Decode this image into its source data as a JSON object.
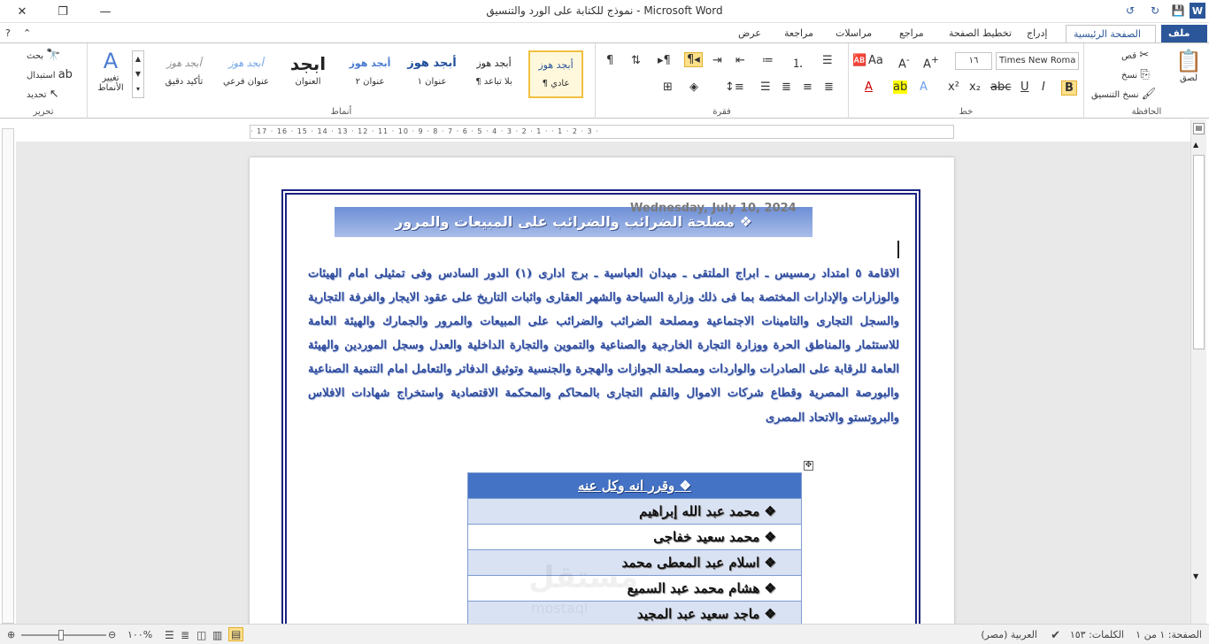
{
  "window": {
    "title": "نموذج للكتابة على الورد والتنسيق  -  Microsoft Word"
  },
  "tabs": [
    {
      "label": "ملف"
    },
    {
      "label": "الصفحة الرئيسية"
    },
    {
      "label": "إدراج"
    },
    {
      "label": "تخطيط الصفحة"
    },
    {
      "label": "مراجع"
    },
    {
      "label": "مراسلات"
    },
    {
      "label": "مراجعة"
    },
    {
      "label": "عرض"
    }
  ],
  "ribbon": {
    "clipboard": {
      "label": "الحافظة",
      "paste": "لصق",
      "cut": "قص",
      "copy": "نسخ",
      "format_painter": "نسخ التنسيق"
    },
    "font": {
      "label": "خط",
      "font_name": "Times New Roma",
      "font_size": "١٦"
    },
    "paragraph": {
      "label": "فقرة"
    },
    "styles": {
      "label": "أنماط",
      "items": [
        {
          "preview": "أبجد هوز",
          "name": "¶ عادي"
        },
        {
          "preview": "أبجد هوز",
          "name": "¶ بلا تباعد"
        },
        {
          "preview": "أبجد هوز",
          "name": "عنوان ١"
        },
        {
          "preview": "أبجد هوز",
          "name": "عنوان ٢"
        },
        {
          "preview": "ابجد",
          "name": "العنوان"
        },
        {
          "preview": "أبجد هوز",
          "name": "عنوان فرعي"
        },
        {
          "preview": "أبجد هوز",
          "name": "تأكيد دقيق"
        }
      ],
      "change_styles": "تغيير الأنماط"
    },
    "editing": {
      "label": "تحرير",
      "find": "بحث",
      "replace": "استبدال",
      "select": "تحديد"
    }
  },
  "ruler": {
    "numbers": "· 17 · 16 · 15 · 14 · 13 · 12 · 11 · 10 · 9 · 8 · 7 · 6 · 5 · 4 · 3 · 2 · 1 ·  · 1 · 2 · 3 ·"
  },
  "document": {
    "banner_title": "❖ مصلحة الضرائب والضرائب على المبيعات والمرور",
    "date_stamp": "Wednesday, July 10, 2024",
    "paragraph": "الاقامة ٥ امتداد رمسيس ـ ابراج الملتقى ـ ميدان العباسية ـ برج ادارى (١) الدور السادس وفى تمثيلى امام الهيئات والوزارات والإدارات المختصة بما فى ذلك وزارة السياحة والشهر العقارى واثبات التاريخ على عقود الايجار والغرفة التجارية والسجل التجارى والتامينات الاجتماعية ومصلحة الضرائب والضرائب على المبيعات والمرور والجمارك والهيئة العامة للاستثمار والمناطق الحرة ووزارة التجارة الخارجية والصناعية والتموين والتجارة الداخلية والعدل وسجل الموردين والهيئة العامة للرقابة على الصادرات والواردات ومصلحة الجوازات والهجرة والجنسية وتوثيق الدفاتر والتعامل امام التنمية الصناعية والبورصة المصرية وقطاع شركات الاموال والقلم التجارى بالمحاكم والمحكمة الاقتصادية واستخراج شهادات الافلاس والبروتستو والاتحاد المصرى",
    "table_header": "❖ وقرر انه وكل عنه",
    "table_rows": [
      "❖ محمد عبد الله إبراهيم",
      "❖ محمد سعيد خفاجى",
      "❖ اسلام عبد المعطى محمد",
      "❖ هشام محمد عبد السميع",
      "❖ ماجد سعيد عبد المجيد"
    ],
    "watermark": "مستقل",
    "watermark_sub": "mostaql"
  },
  "status": {
    "page": "الصفحة: ١ من ١",
    "words": "الكلمات: ١٥٣",
    "language": "العربية (مصر)",
    "zoom": "١٠٠%"
  },
  "colors": {
    "accent": "#2b579a",
    "banner": "#8aa6e0",
    "table_header": "#4472c4",
    "frame": "#1a237e"
  }
}
